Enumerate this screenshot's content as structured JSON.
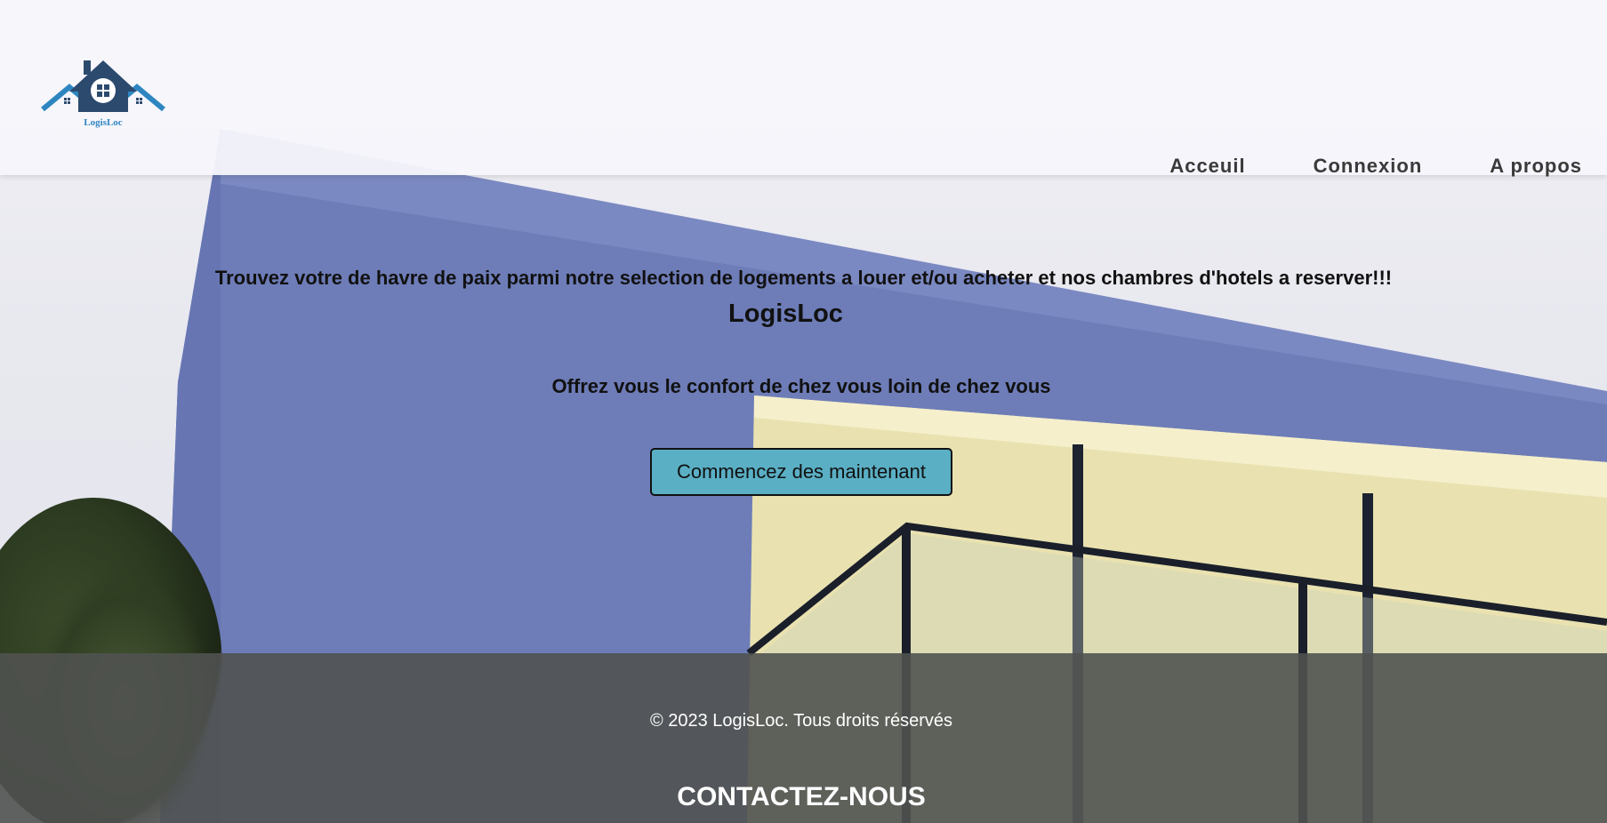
{
  "brand": {
    "logo_text": "LogisLoc",
    "logo_icon": "house-roof-icon"
  },
  "nav": {
    "items": [
      {
        "label": "Acceuil"
      },
      {
        "label": "Connexion"
      },
      {
        "label": "A propos"
      }
    ]
  },
  "hero": {
    "tagline": "Trouvez votre de havre de paix parmi notre selection de logements a louer et/ou acheter et nos chambres d'hotels a reserver!!!",
    "title": "LogisLoc",
    "subtitle": "Offrez vous le confort de chez vous loin de chez vous",
    "cta_label": "Commencez des maintenant"
  },
  "footer": {
    "copyright": "© 2023 LogisLoc. Tous droits réservés",
    "contact_heading": "CONTACTEZ-NOUS"
  },
  "colors": {
    "header_bg": "#f6f6fb",
    "cta_bg": "#5aafc4",
    "footer_bg": "#505250",
    "logo_blue": "#2e86c1",
    "logo_dark": "#2c4a6e"
  }
}
